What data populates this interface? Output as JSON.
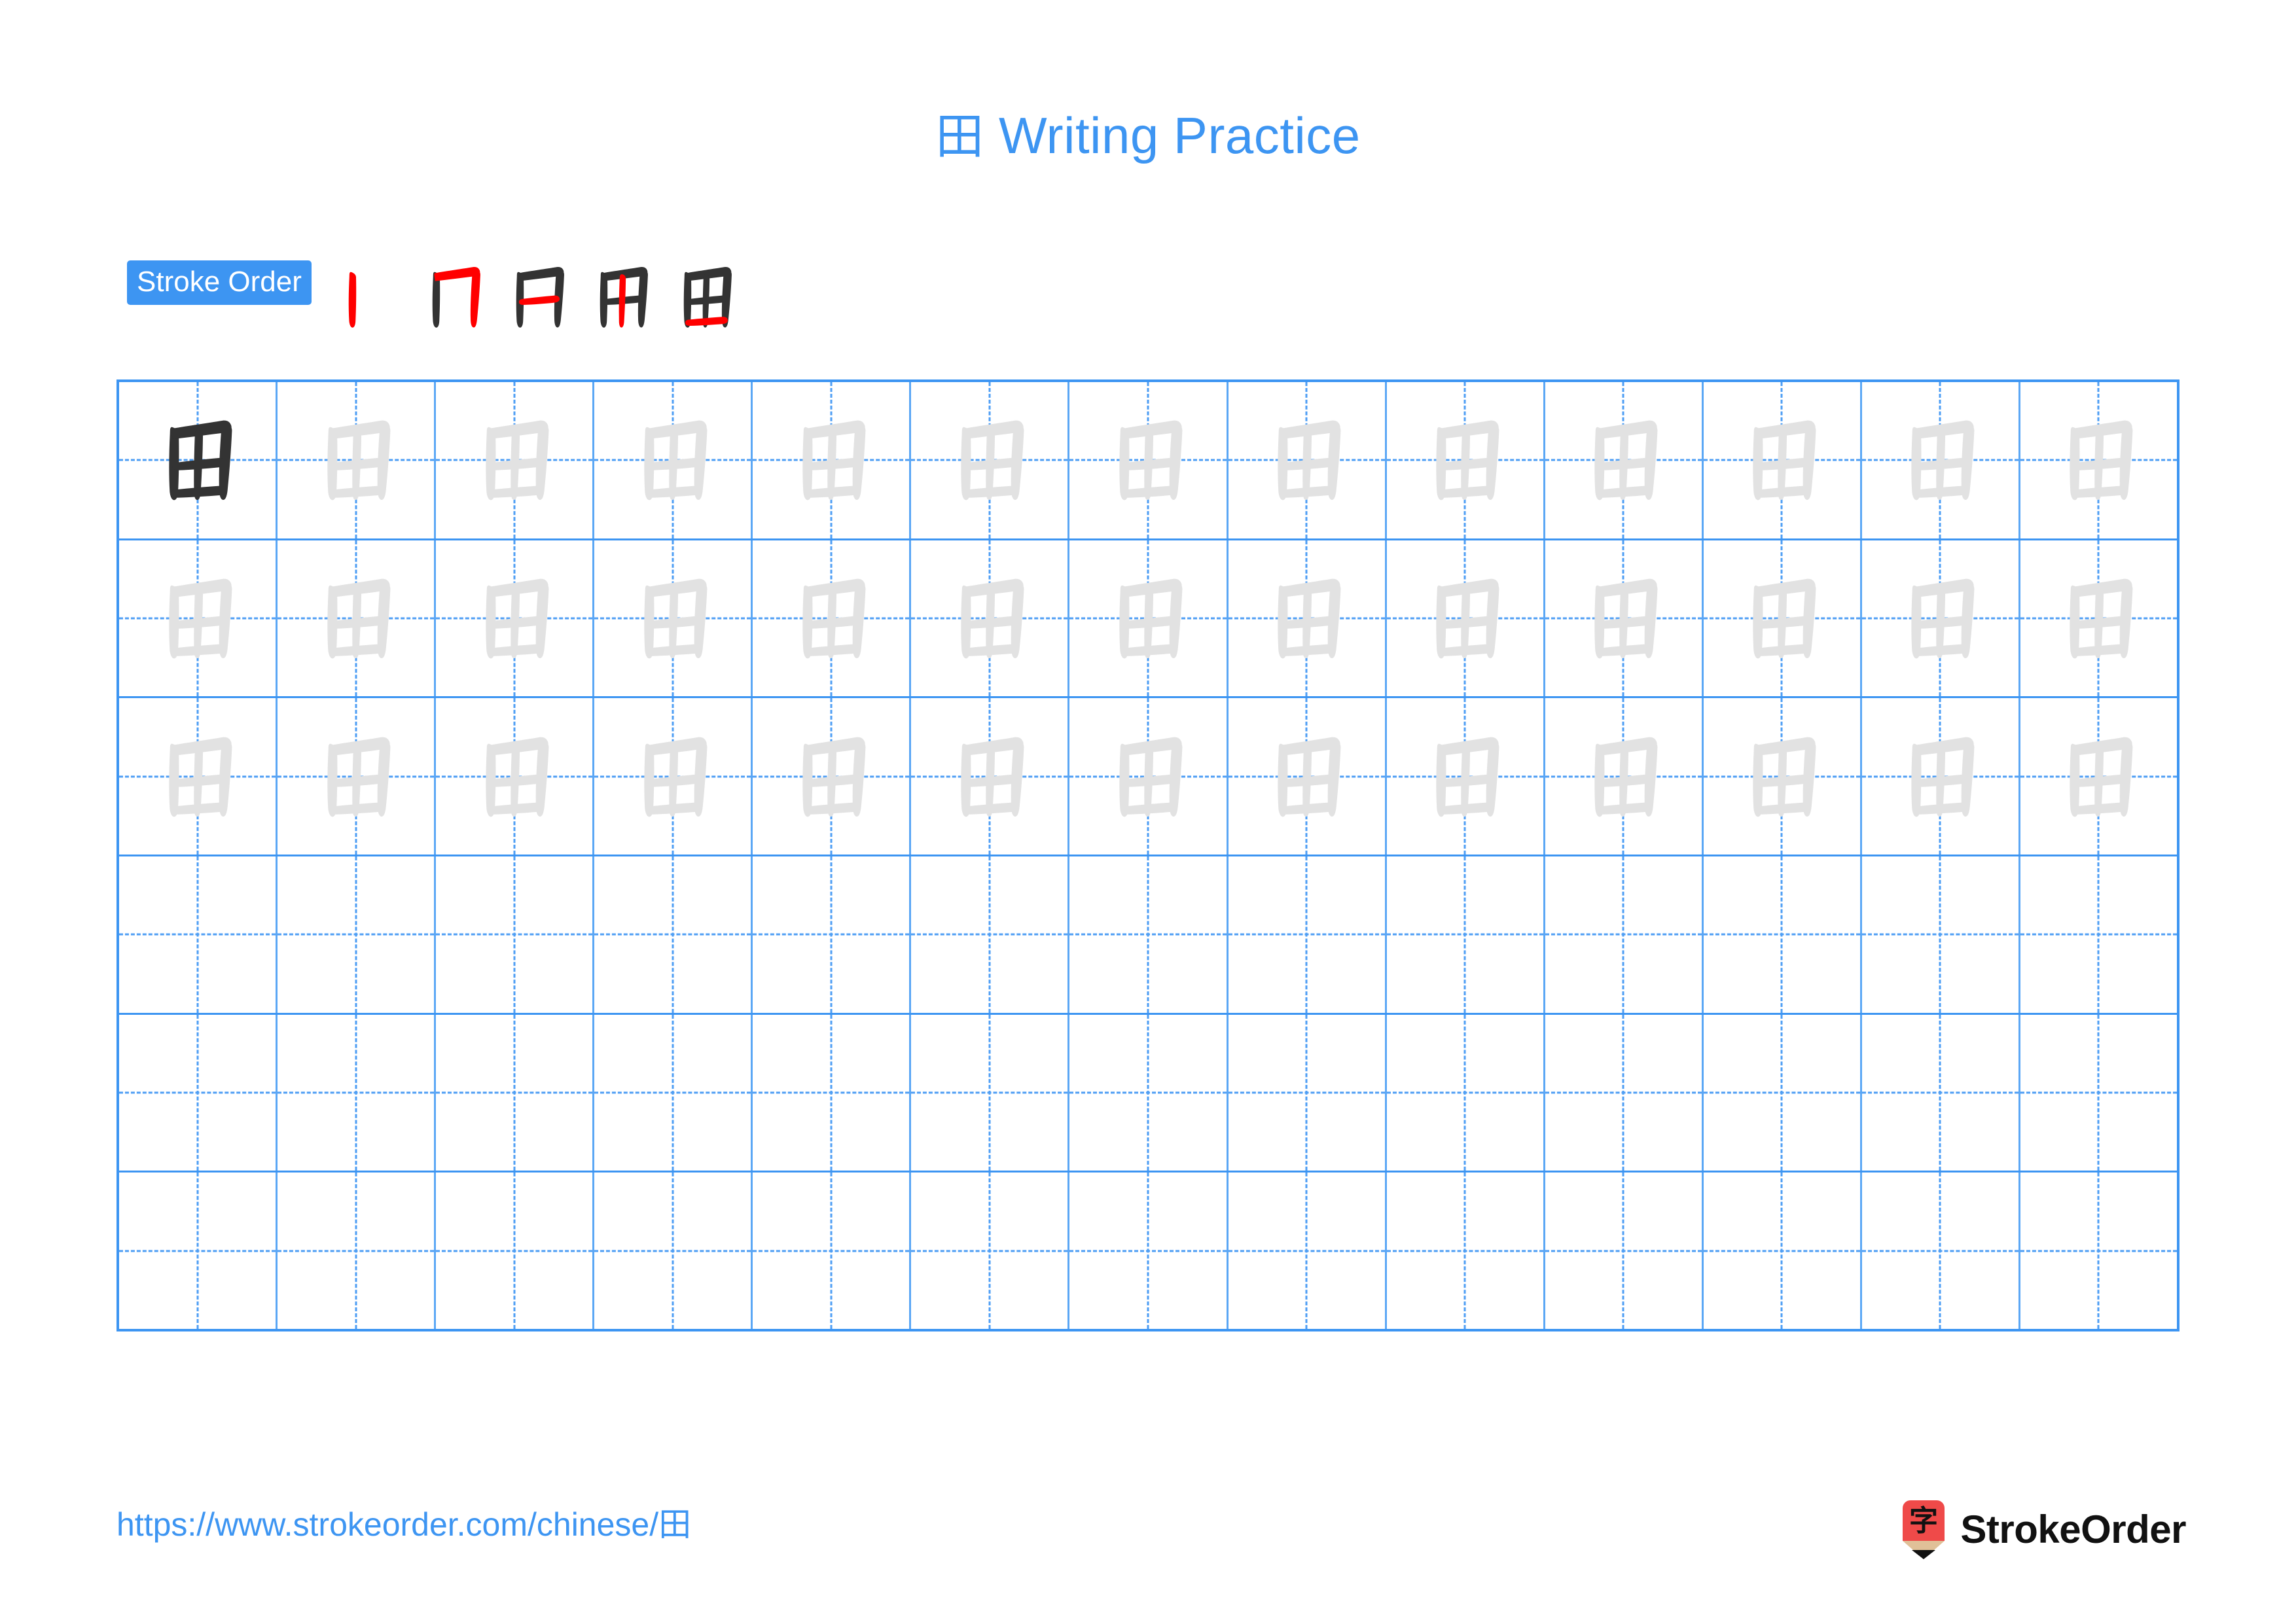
{
  "page": {
    "character": "田",
    "title_text": "Writing Practice",
    "accent_color": "#3d95f2",
    "trace_color": "#e2e2e2",
    "ink_color": "#333333",
    "highlight_stroke_color": "#ff0000"
  },
  "stroke_order": {
    "badge_label": "Stroke Order",
    "steps": [
      {
        "index": 1,
        "name": "stroke-step-1",
        "new_stroke": "vertical-left"
      },
      {
        "index": 2,
        "name": "stroke-step-2",
        "new_stroke": "horizontal-top-and-vertical-right-hook"
      },
      {
        "index": 3,
        "name": "stroke-step-3",
        "new_stroke": "horizontal-middle"
      },
      {
        "index": 4,
        "name": "stroke-step-4",
        "new_stroke": "vertical-middle"
      },
      {
        "index": 5,
        "name": "stroke-step-5",
        "new_stroke": "horizontal-bottom"
      }
    ],
    "total_strokes": 5
  },
  "practice_grid": {
    "columns": 13,
    "rows": 6,
    "cells": [
      [
        "ink",
        "trace",
        "trace",
        "trace",
        "trace",
        "trace",
        "trace",
        "trace",
        "trace",
        "trace",
        "trace",
        "trace",
        "trace"
      ],
      [
        "trace",
        "trace",
        "trace",
        "trace",
        "trace",
        "trace",
        "trace",
        "trace",
        "trace",
        "trace",
        "trace",
        "trace",
        "trace"
      ],
      [
        "trace",
        "trace",
        "trace",
        "trace",
        "trace",
        "trace",
        "trace",
        "trace",
        "trace",
        "trace",
        "trace",
        "trace",
        "trace"
      ],
      [
        "empty",
        "empty",
        "empty",
        "empty",
        "empty",
        "empty",
        "empty",
        "empty",
        "empty",
        "empty",
        "empty",
        "empty",
        "empty"
      ],
      [
        "empty",
        "empty",
        "empty",
        "empty",
        "empty",
        "empty",
        "empty",
        "empty",
        "empty",
        "empty",
        "empty",
        "empty",
        "empty"
      ],
      [
        "empty",
        "empty",
        "empty",
        "empty",
        "empty",
        "empty",
        "empty",
        "empty",
        "empty",
        "empty",
        "empty",
        "empty",
        "empty"
      ]
    ]
  },
  "footer": {
    "url": "https://www.strokeorder.com/chinese/田",
    "brand_name": "StrokeOrder",
    "brand_mark_character": "字",
    "brand_mark_body_color": "#ef4a49",
    "brand_mark_wood_color": "#e0c098",
    "brand_mark_tip_color": "#111111"
  }
}
